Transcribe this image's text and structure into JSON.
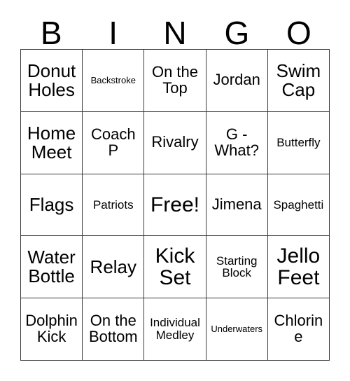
{
  "card": {
    "title_letters": [
      "B",
      "I",
      "N",
      "G",
      "O"
    ],
    "grid": {
      "rows": 5,
      "columns": 5,
      "border_color": "#3a3a3a",
      "background_color": "#ffffff",
      "text_color": "#000000"
    },
    "cells": [
      [
        {
          "label": "Donut Holes",
          "size": "lg"
        },
        {
          "label": "Backstroke",
          "size": "xs"
        },
        {
          "label": "On the Top",
          "size": "md"
        },
        {
          "label": "Jordan",
          "size": "md"
        },
        {
          "label": "Swim Cap",
          "size": "lg"
        }
      ],
      [
        {
          "label": "Home Meet",
          "size": "lg"
        },
        {
          "label": "Coach P",
          "size": "md"
        },
        {
          "label": "Rivalry",
          "size": "md"
        },
        {
          "label": "G - What?",
          "size": "md"
        },
        {
          "label": "Butterfly",
          "size": "sm"
        }
      ],
      [
        {
          "label": "Flags",
          "size": "lg"
        },
        {
          "label": "Patriots",
          "size": "sm"
        },
        {
          "label": "Free!",
          "size": "xl"
        },
        {
          "label": "Jimena",
          "size": "md"
        },
        {
          "label": "Spaghetti",
          "size": "sm"
        }
      ],
      [
        {
          "label": "Water Bottle",
          "size": "lg"
        },
        {
          "label": "Relay",
          "size": "lg"
        },
        {
          "label": "Kick Set",
          "size": "xl"
        },
        {
          "label": "Starting Block",
          "size": "sm"
        },
        {
          "label": "Jello Feet",
          "size": "xl"
        }
      ],
      [
        {
          "label": "Dolphin Kick",
          "size": "md"
        },
        {
          "label": "On the Bottom",
          "size": "md"
        },
        {
          "label": "Individual Medley",
          "size": "sm"
        },
        {
          "label": "Underwaters",
          "size": "xs"
        },
        {
          "label": "Chlorine",
          "size": "md"
        }
      ]
    ]
  }
}
